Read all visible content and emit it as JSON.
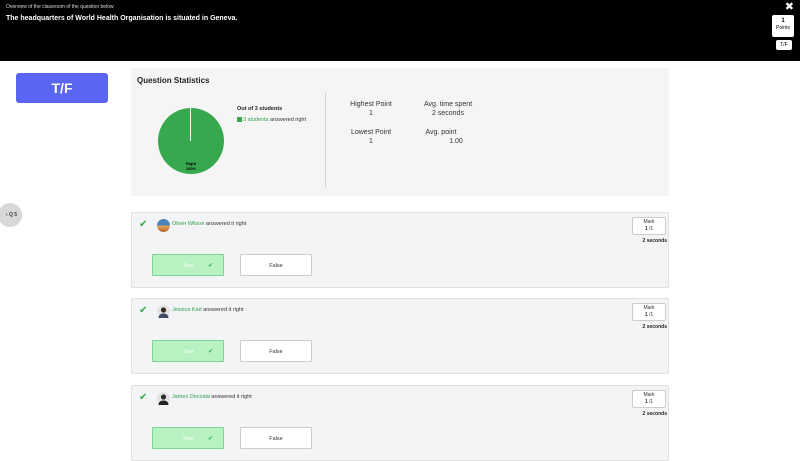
{
  "header": {
    "subtitle": "Overview of the classroom of the question below",
    "question": "The headquarters of World Health Organisation is situated in Geneva.",
    "close_icon": "close-icon",
    "points_value": "1",
    "points_label": "Points",
    "type_chip": "T/F"
  },
  "type_badge": "T/F",
  "nav": {
    "label": "Q 5",
    "icon": "chevron-left-icon"
  },
  "stats": {
    "title": "Question Statistics",
    "out_of": "Out of 3 students",
    "legend_count": "3 students",
    "legend_suffix": " answered right",
    "pie_label": "Right",
    "pie_percent": "100%",
    "highest_point_label": "Highest Point",
    "highest_point_value": "1",
    "avg_time_label": "Avg. time spent",
    "avg_time_value": "2 seconds",
    "lowest_point_label": "Lowest Point",
    "lowest_point_value": "1",
    "avg_point_label": "Avg. point",
    "avg_point_value": "1.00",
    "colors": {
      "right": "#38a84e"
    }
  },
  "answers": [
    {
      "name": "Oliver Wilson",
      "suffix": " answered it right",
      "mark_label": "Mark",
      "mark_value": "1",
      "mark_total": "/1",
      "time": "2 seconds",
      "true_label": "True",
      "false_label": "False"
    },
    {
      "name": "Jessica Karl",
      "suffix": " answered it right",
      "mark_label": "Mark",
      "mark_value": "1",
      "mark_total": "/1",
      "time": "2 seconds",
      "true_label": "True",
      "false_label": "False"
    },
    {
      "name": "James Decosta",
      "suffix": " answered it right",
      "mark_label": "Mark",
      "mark_value": "1",
      "mark_total": "/1",
      "time": "2 seconds",
      "true_label": "True",
      "false_label": "False"
    }
  ]
}
